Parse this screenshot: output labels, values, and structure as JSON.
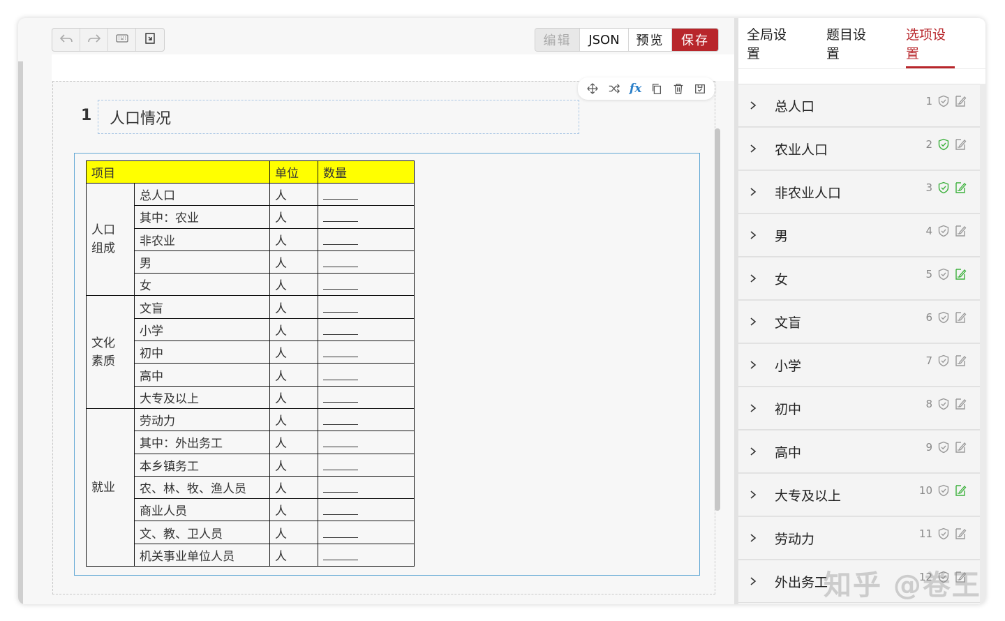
{
  "toolbar": {
    "buttons": [
      "undo-icon",
      "redo-icon",
      "keyboard-icon",
      "import-icon"
    ],
    "modes": {
      "edit": "编辑",
      "json": "JSON",
      "preview": "预览",
      "save": "保存"
    }
  },
  "question": {
    "number": "1",
    "title": "人口情况",
    "tools": [
      "move-icon",
      "shuffle-icon",
      "fx-icon",
      "copy-icon",
      "delete-icon",
      "save-icon"
    ],
    "fx_label": "fx",
    "table": {
      "headers": [
        "项目",
        "单位",
        "数量"
      ],
      "groups": [
        {
          "name": "人口\n组成",
          "rows": [
            "总人口",
            "其中：农业",
            "非农业",
            "男",
            "女"
          ]
        },
        {
          "name": "文化\n素质",
          "rows": [
            "文盲",
            "小学",
            "初中",
            "高中",
            "大专及以上"
          ]
        },
        {
          "name": "就业",
          "rows": [
            "劳动力",
            "其中：外出务工",
            "本乡镇务工",
            "农、林、牧、渔人员",
            "商业人员",
            "文、教、卫人员",
            "机关事业单位人员"
          ]
        }
      ],
      "unit": "人"
    }
  },
  "panel": {
    "tabs": [
      "全局设置",
      "题目设置",
      "选项设置"
    ],
    "active_tab": "选项设置",
    "options": [
      {
        "label": "总人口",
        "num": "1",
        "check_green": false,
        "edit_green": false
      },
      {
        "label": "农业人口",
        "num": "2",
        "check_green": true,
        "edit_green": false
      },
      {
        "label": "非农业人口",
        "num": "3",
        "check_green": true,
        "edit_green": true
      },
      {
        "label": "男",
        "num": "4",
        "check_green": false,
        "edit_green": false
      },
      {
        "label": "女",
        "num": "5",
        "check_green": false,
        "edit_green": true
      },
      {
        "label": "文盲",
        "num": "6",
        "check_green": false,
        "edit_green": false
      },
      {
        "label": "小学",
        "num": "7",
        "check_green": false,
        "edit_green": false
      },
      {
        "label": "初中",
        "num": "8",
        "check_green": false,
        "edit_green": false
      },
      {
        "label": "高中",
        "num": "9",
        "check_green": false,
        "edit_green": false
      },
      {
        "label": "大专及以上",
        "num": "10",
        "check_green": false,
        "edit_green": true
      },
      {
        "label": "劳动力",
        "num": "11",
        "check_green": false,
        "edit_green": false
      },
      {
        "label": "外出务工",
        "num": "12",
        "check_green": false,
        "edit_green": false
      }
    ],
    "colors": {
      "accent": "#b8262b",
      "green": "#3db13d",
      "gray_icon": "#999999"
    }
  },
  "watermark": "知乎 @卷王"
}
